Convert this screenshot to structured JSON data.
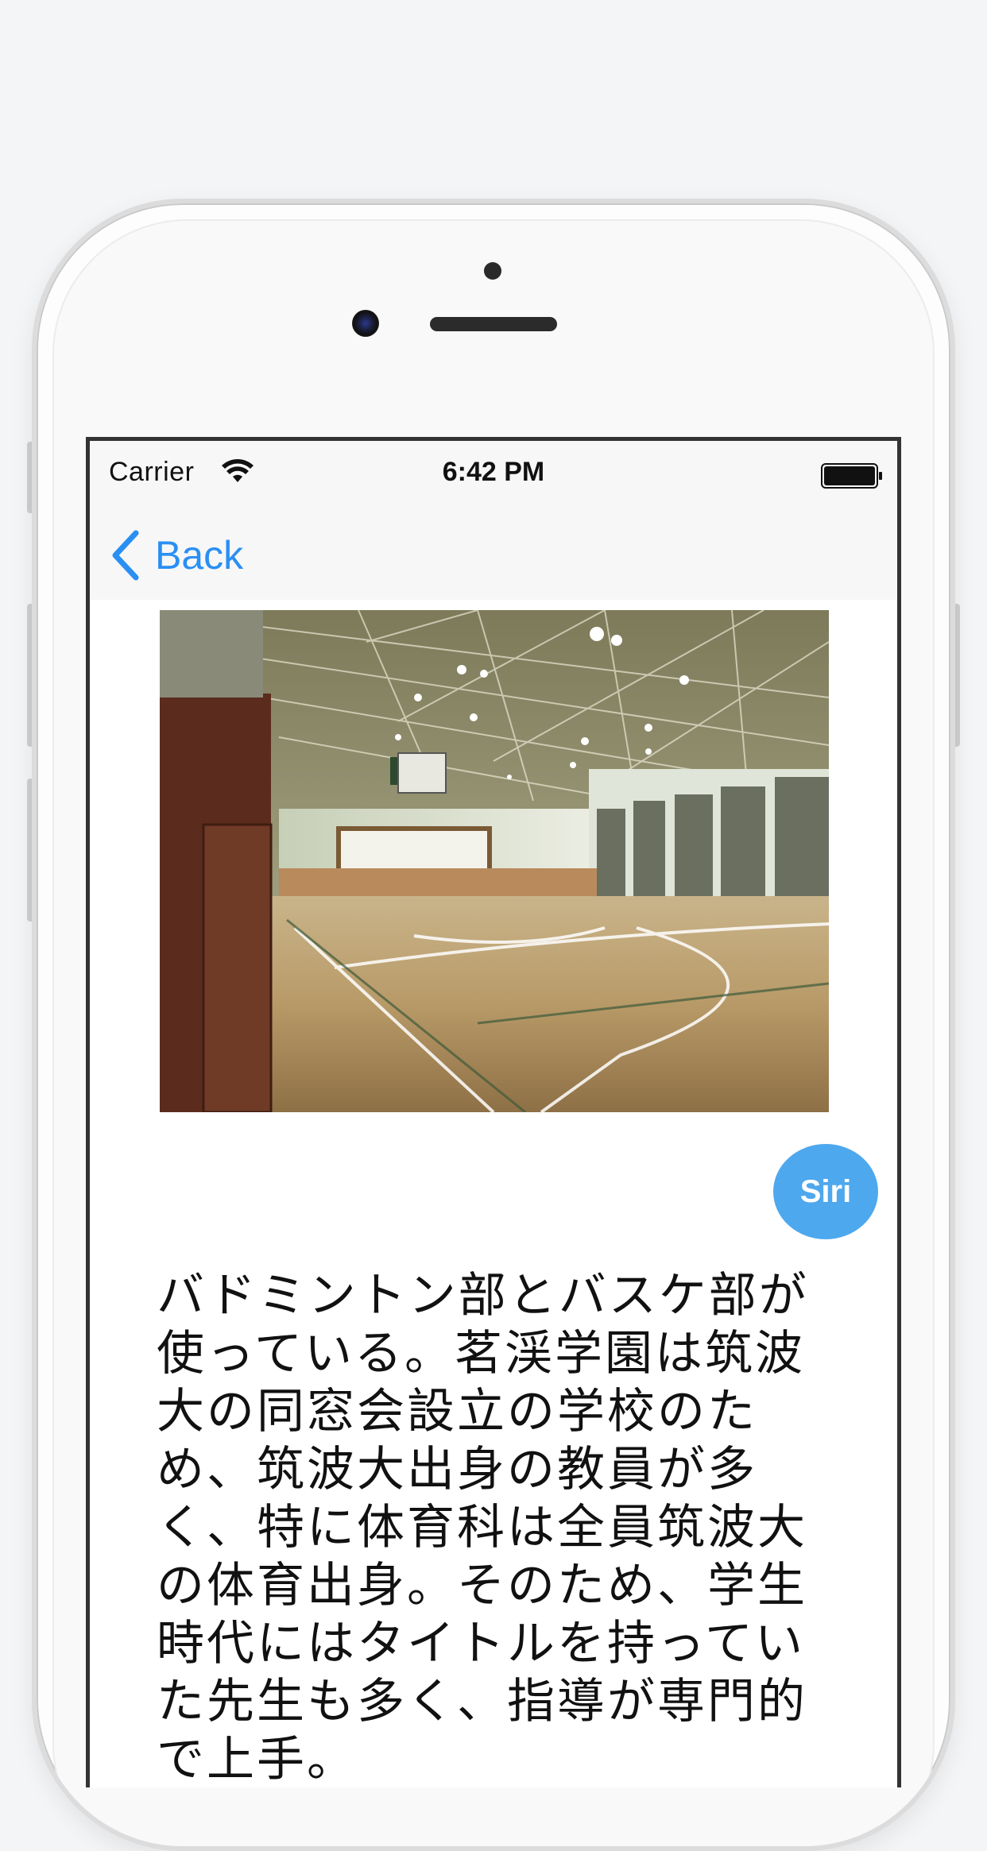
{
  "status_bar": {
    "carrier": "Carrier",
    "time": "6:42 PM",
    "wifi_icon": "wifi-icon",
    "battery_icon": "battery-icon"
  },
  "nav": {
    "back_label": "Back",
    "back_icon": "chevron-left-icon"
  },
  "content": {
    "photo": "gymnasium-photo",
    "siri_label": "Siri",
    "description": "バドミントン部とバスケ部が使っている。茗渓学園は筑波大の同窓会設立の学校のため、筑波大出身の教員が多く、特に体育科は全員筑波大の体育出身。そのため、学生時代にはタイトルを持っていた先生も多く、指導が専門的で上手。"
  },
  "colors": {
    "accent": "#2a8ff3",
    "siri": "#4ea8ee",
    "background": "#f4f5f7"
  }
}
